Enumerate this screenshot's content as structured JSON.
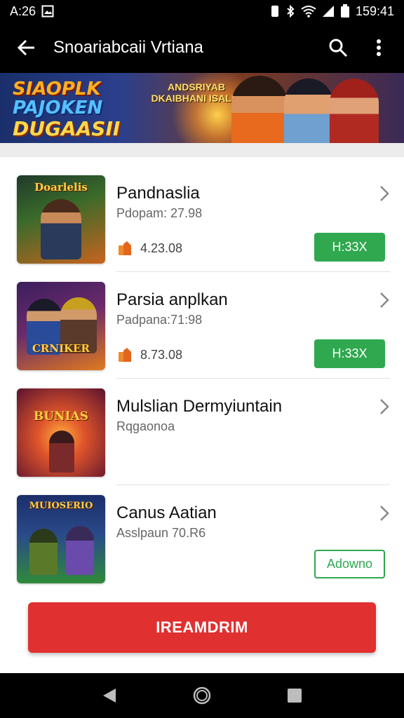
{
  "status_bar": {
    "left_time": "A:26",
    "right_time": "159:41",
    "icons_left": [
      "image-icon"
    ],
    "icons_right": [
      "vibrate-icon",
      "bluetooth-icon",
      "wifi-icon",
      "signal-icon",
      "battery-icon"
    ]
  },
  "app_bar": {
    "title": "Snoariabcaii Vrtiana",
    "back_icon": "arrow-left-icon",
    "search_icon": "search-icon",
    "menu_icon": "more-vert-icon"
  },
  "banner": {
    "line1": "SIAOPLK",
    "line2": "PAJOKEN",
    "line3": "DUGAASII",
    "mid_line1": "ANDSRIYAB",
    "mid_line2": "DKAIBHANI ISALIG"
  },
  "items": [
    {
      "title": "Pandnaslia",
      "subtitle": "Pdopam: 27.98",
      "meta_text": "4.23.08",
      "badge": "H:33X",
      "badge_style": "filled",
      "thumb_title": "Doarlelis",
      "thumb_colors": [
        "#1f3b2a",
        "#c8641e"
      ]
    },
    {
      "title": "Parsia anplkan",
      "subtitle": "Padpana:71:98",
      "meta_text": "8.73.08",
      "badge": "H:33X",
      "badge_style": "filled",
      "thumb_title": "CRNIKER",
      "thumb_colors": [
        "#3b1e5e",
        "#e07a1e"
      ]
    },
    {
      "title": "Mulslian Dermyiuntain",
      "subtitle": "Rqgaonoa",
      "meta_text": "",
      "badge": "",
      "badge_style": "none",
      "thumb_title": "BUNIAS",
      "thumb_colors": [
        "#5a1230",
        "#e0552a"
      ]
    },
    {
      "title": "Canus Aatian",
      "subtitle": "Asslpaun 70.R6",
      "meta_text": "",
      "badge": "Adowno",
      "badge_style": "outline",
      "thumb_title": "MUIOSERIO",
      "thumb_colors": [
        "#1b2e6a",
        "#2f8a3a"
      ]
    }
  ],
  "primary_button": {
    "label": "IREAMDRIM"
  },
  "nav_bar": {
    "back": "nav-back-icon",
    "home": "nav-home-icon",
    "recents": "nav-recents-icon"
  },
  "colors": {
    "accent_green": "#2fa84f",
    "primary_red": "#e03030",
    "bar_black": "#000000"
  }
}
